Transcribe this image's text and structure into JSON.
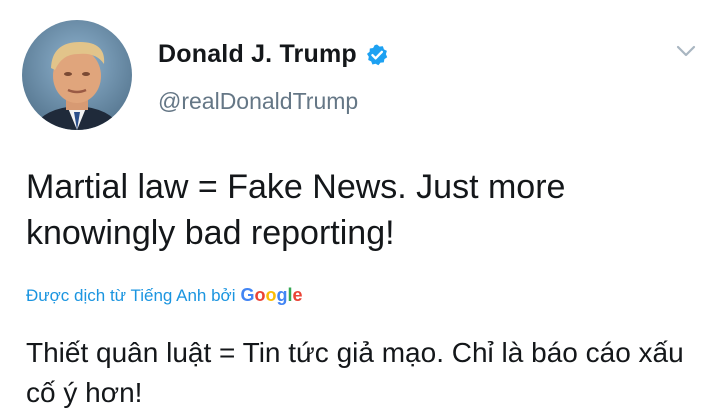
{
  "tweet": {
    "display_name": "Donald J. Trump",
    "handle": "@realDonaldTrump",
    "verified": true,
    "text": "Martial law = Fake News. Just more knowingly bad reporting!",
    "translated_by_label": "Được dịch từ Tiếng Anh bởi",
    "translation_provider": "Google",
    "translation_text": "Thiết quân luật = Tin tức giả mạo. Chỉ là báo cáo xấu cố ý hơn!"
  },
  "icons": {
    "verified": "verified-badge-icon",
    "caret": "chevron-down-icon"
  },
  "colors": {
    "link_blue": "#1b95e0",
    "verified_blue": "#1da1f2",
    "handle_gray": "#657786",
    "text": "#14171a"
  }
}
